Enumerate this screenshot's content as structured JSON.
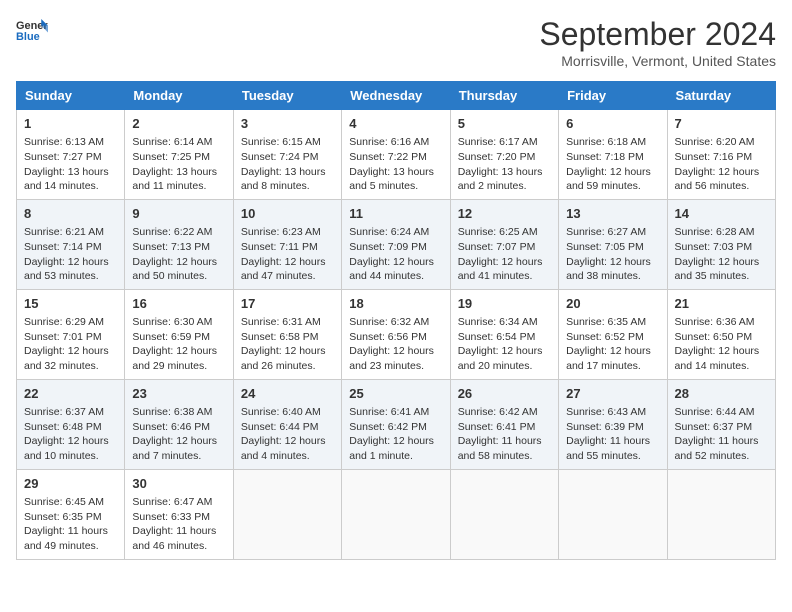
{
  "header": {
    "logo_line1": "General",
    "logo_line2": "Blue",
    "month": "September 2024",
    "location": "Morrisville, Vermont, United States"
  },
  "days_of_week": [
    "Sunday",
    "Monday",
    "Tuesday",
    "Wednesday",
    "Thursday",
    "Friday",
    "Saturday"
  ],
  "weeks": [
    [
      {
        "day": "1",
        "info": "Sunrise: 6:13 AM\nSunset: 7:27 PM\nDaylight: 13 hours\nand 14 minutes."
      },
      {
        "day": "2",
        "info": "Sunrise: 6:14 AM\nSunset: 7:25 PM\nDaylight: 13 hours\nand 11 minutes."
      },
      {
        "day": "3",
        "info": "Sunrise: 6:15 AM\nSunset: 7:24 PM\nDaylight: 13 hours\nand 8 minutes."
      },
      {
        "day": "4",
        "info": "Sunrise: 6:16 AM\nSunset: 7:22 PM\nDaylight: 13 hours\nand 5 minutes."
      },
      {
        "day": "5",
        "info": "Sunrise: 6:17 AM\nSunset: 7:20 PM\nDaylight: 13 hours\nand 2 minutes."
      },
      {
        "day": "6",
        "info": "Sunrise: 6:18 AM\nSunset: 7:18 PM\nDaylight: 12 hours\nand 59 minutes."
      },
      {
        "day": "7",
        "info": "Sunrise: 6:20 AM\nSunset: 7:16 PM\nDaylight: 12 hours\nand 56 minutes."
      }
    ],
    [
      {
        "day": "8",
        "info": "Sunrise: 6:21 AM\nSunset: 7:14 PM\nDaylight: 12 hours\nand 53 minutes."
      },
      {
        "day": "9",
        "info": "Sunrise: 6:22 AM\nSunset: 7:13 PM\nDaylight: 12 hours\nand 50 minutes."
      },
      {
        "day": "10",
        "info": "Sunrise: 6:23 AM\nSunset: 7:11 PM\nDaylight: 12 hours\nand 47 minutes."
      },
      {
        "day": "11",
        "info": "Sunrise: 6:24 AM\nSunset: 7:09 PM\nDaylight: 12 hours\nand 44 minutes."
      },
      {
        "day": "12",
        "info": "Sunrise: 6:25 AM\nSunset: 7:07 PM\nDaylight: 12 hours\nand 41 minutes."
      },
      {
        "day": "13",
        "info": "Sunrise: 6:27 AM\nSunset: 7:05 PM\nDaylight: 12 hours\nand 38 minutes."
      },
      {
        "day": "14",
        "info": "Sunrise: 6:28 AM\nSunset: 7:03 PM\nDaylight: 12 hours\nand 35 minutes."
      }
    ],
    [
      {
        "day": "15",
        "info": "Sunrise: 6:29 AM\nSunset: 7:01 PM\nDaylight: 12 hours\nand 32 minutes."
      },
      {
        "day": "16",
        "info": "Sunrise: 6:30 AM\nSunset: 6:59 PM\nDaylight: 12 hours\nand 29 minutes."
      },
      {
        "day": "17",
        "info": "Sunrise: 6:31 AM\nSunset: 6:58 PM\nDaylight: 12 hours\nand 26 minutes."
      },
      {
        "day": "18",
        "info": "Sunrise: 6:32 AM\nSunset: 6:56 PM\nDaylight: 12 hours\nand 23 minutes."
      },
      {
        "day": "19",
        "info": "Sunrise: 6:34 AM\nSunset: 6:54 PM\nDaylight: 12 hours\nand 20 minutes."
      },
      {
        "day": "20",
        "info": "Sunrise: 6:35 AM\nSunset: 6:52 PM\nDaylight: 12 hours\nand 17 minutes."
      },
      {
        "day": "21",
        "info": "Sunrise: 6:36 AM\nSunset: 6:50 PM\nDaylight: 12 hours\nand 14 minutes."
      }
    ],
    [
      {
        "day": "22",
        "info": "Sunrise: 6:37 AM\nSunset: 6:48 PM\nDaylight: 12 hours\nand 10 minutes."
      },
      {
        "day": "23",
        "info": "Sunrise: 6:38 AM\nSunset: 6:46 PM\nDaylight: 12 hours\nand 7 minutes."
      },
      {
        "day": "24",
        "info": "Sunrise: 6:40 AM\nSunset: 6:44 PM\nDaylight: 12 hours\nand 4 minutes."
      },
      {
        "day": "25",
        "info": "Sunrise: 6:41 AM\nSunset: 6:42 PM\nDaylight: 12 hours\nand 1 minute."
      },
      {
        "day": "26",
        "info": "Sunrise: 6:42 AM\nSunset: 6:41 PM\nDaylight: 11 hours\nand 58 minutes."
      },
      {
        "day": "27",
        "info": "Sunrise: 6:43 AM\nSunset: 6:39 PM\nDaylight: 11 hours\nand 55 minutes."
      },
      {
        "day": "28",
        "info": "Sunrise: 6:44 AM\nSunset: 6:37 PM\nDaylight: 11 hours\nand 52 minutes."
      }
    ],
    [
      {
        "day": "29",
        "info": "Sunrise: 6:45 AM\nSunset: 6:35 PM\nDaylight: 11 hours\nand 49 minutes."
      },
      {
        "day": "30",
        "info": "Sunrise: 6:47 AM\nSunset: 6:33 PM\nDaylight: 11 hours\nand 46 minutes."
      },
      {
        "day": "",
        "info": ""
      },
      {
        "day": "",
        "info": ""
      },
      {
        "day": "",
        "info": ""
      },
      {
        "day": "",
        "info": ""
      },
      {
        "day": "",
        "info": ""
      }
    ]
  ]
}
